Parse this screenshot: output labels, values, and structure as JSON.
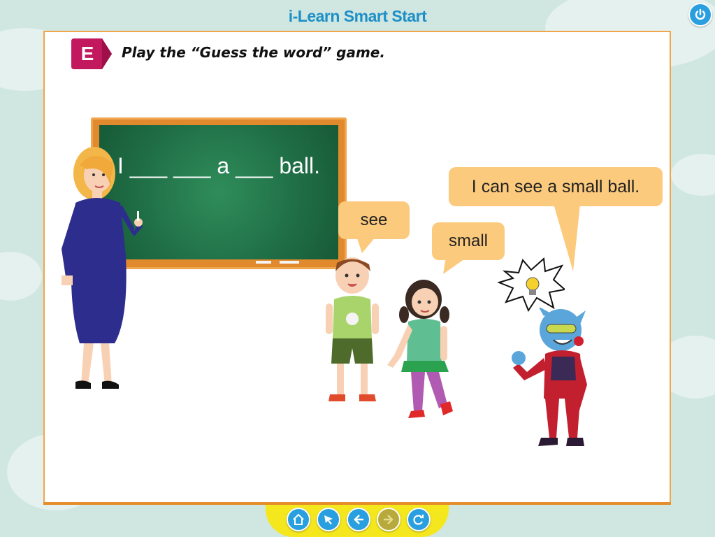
{
  "app": {
    "title": "i-Learn Smart Start"
  },
  "exercise": {
    "tag_letter": "E",
    "instruction": "Play the “Guess the word” game."
  },
  "board": {
    "sentence": "I ___ ___ a ___ ball."
  },
  "bubbles": {
    "boy": "see",
    "girl": "small",
    "alien": "I can see a small ball."
  },
  "nav": {
    "buttons": [
      "home-icon",
      "pointer-icon",
      "back-arrow-icon",
      "forward-arrow-icon",
      "refresh-icon"
    ]
  },
  "colors": {
    "accent_blue": "#2a9fe0",
    "frame_orange": "#f0a54b",
    "tag_magenta": "#c1185e",
    "board_green": "#1f6d45",
    "bubble_orange": "#fcca7d",
    "nav_yellow": "#f4e71e",
    "disabled_olive": "#b8a93c"
  }
}
